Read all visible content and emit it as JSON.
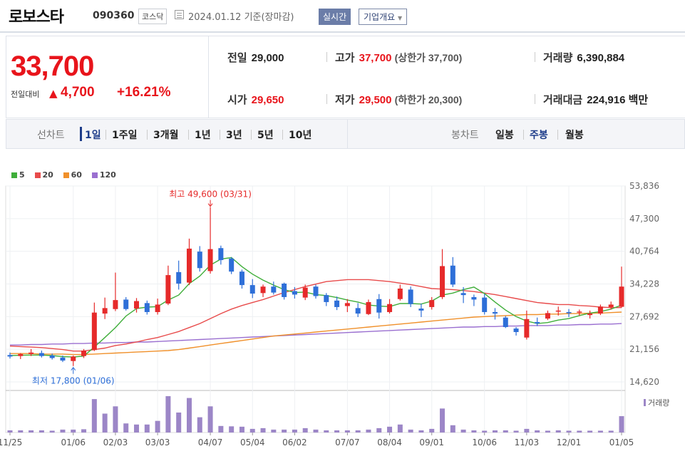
{
  "header": {
    "name": "로보스타",
    "code": "090360",
    "market": "코스닥",
    "date_text": "2024.01.12  기준(장마감)",
    "realtime_btn": "실시간",
    "corp_btn": "기업개요"
  },
  "quote": {
    "price": "33,700",
    "change_label": "전일대비",
    "change": "4,700",
    "change_pct": "+16.21%"
  },
  "info": {
    "prev_label": "전일",
    "prev": "29,000",
    "high_label": "고가",
    "high": "37,700",
    "upper_limit": "(상한가 37,700)",
    "volume_label": "거래량",
    "volume": "6,390,884",
    "open_label": "시가",
    "open": "29,650",
    "low_label": "저가",
    "low": "29,500",
    "lower_limit": "(하한가 20,300)",
    "amount_label": "거래대금",
    "amount": "224,916 백만"
  },
  "tabs": {
    "line_label": "선차트",
    "line_periods": [
      "1일",
      "1주일",
      "3개월",
      "1년",
      "3년",
      "5년",
      "10년"
    ],
    "candle_label": "봉차트",
    "candle_periods": [
      "일봉",
      "주봉",
      "월봉"
    ],
    "active_candle": "주봉"
  },
  "legend": [
    {
      "name": "5",
      "color": "#3fae3a"
    },
    {
      "name": "20",
      "color": "#e84b4b"
    },
    {
      "name": "60",
      "color": "#f0902a"
    },
    {
      "name": "120",
      "color": "#9a6fd0"
    }
  ],
  "chart_data": {
    "type": "candlestick",
    "period": "weekly",
    "y_ticks": [
      "53,836",
      "47,300",
      "40,764",
      "34,228",
      "27,692",
      "21,156",
      "14,620"
    ],
    "y_tick_values": [
      53836,
      47300,
      40764,
      34228,
      27692,
      21156,
      14620
    ],
    "x_ticks": [
      "11/25",
      "01/06",
      "02/03",
      "03/03",
      "04/07",
      "05/04",
      "06/02",
      "07/07",
      "08/04",
      "09/01",
      "10/06",
      "11/03",
      "12/01",
      "01/05"
    ],
    "x_tick_index": [
      0,
      6,
      10,
      14,
      19,
      23,
      27,
      32,
      36,
      40,
      45,
      49,
      53,
      58
    ],
    "high_annotation": "최고 49,600 (03/31)",
    "low_annotation": "최저 17,800 (01/06)",
    "volume_label": "거래량",
    "candles": [
      [
        20000,
        20500,
        19300,
        19700
      ],
      [
        19800,
        20400,
        19200,
        20200
      ],
      [
        20200,
        21200,
        19800,
        20500
      ],
      [
        20400,
        20900,
        19500,
        19800
      ],
      [
        19900,
        20300,
        19100,
        19400
      ],
      [
        19500,
        19900,
        18600,
        18900
      ],
      [
        18800,
        19900,
        17800,
        19700
      ],
      [
        19800,
        21200,
        19400,
        20900
      ],
      [
        21000,
        30500,
        20800,
        28500
      ],
      [
        28300,
        31500,
        27200,
        29400
      ],
      [
        29200,
        36500,
        28800,
        31000
      ],
      [
        31100,
        31600,
        28900,
        29200
      ],
      [
        29300,
        31400,
        28500,
        30800
      ],
      [
        30400,
        30900,
        28100,
        28600
      ],
      [
        28600,
        31300,
        28100,
        30100
      ],
      [
        30300,
        37900,
        30000,
        36000
      ],
      [
        36600,
        38900,
        33100,
        34300
      ],
      [
        34500,
        43300,
        34000,
        41300
      ],
      [
        40700,
        41800,
        36700,
        37400
      ],
      [
        36800,
        49600,
        36300,
        41200
      ],
      [
        41400,
        41900,
        38100,
        39000
      ],
      [
        39300,
        39600,
        36200,
        36700
      ],
      [
        36700,
        37100,
        33300,
        34000
      ],
      [
        34000,
        35200,
        31400,
        32300
      ],
      [
        32400,
        34100,
        31600,
        33700
      ],
      [
        33700,
        34700,
        32100,
        32500
      ],
      [
        34300,
        34500,
        31100,
        31600
      ],
      [
        32800,
        33600,
        31300,
        32100
      ],
      [
        31500,
        34100,
        31000,
        33500
      ],
      [
        33700,
        34100,
        31300,
        31800
      ],
      [
        32000,
        32400,
        29800,
        30600
      ],
      [
        30900,
        31700,
        29000,
        29600
      ],
      [
        29800,
        31200,
        28600,
        30400
      ],
      [
        29400,
        30400,
        27600,
        28300
      ],
      [
        28200,
        31100,
        28000,
        30600
      ],
      [
        31200,
        32200,
        27300,
        28500
      ],
      [
        28600,
        31200,
        28300,
        30200
      ],
      [
        31200,
        34100,
        30900,
        33300
      ],
      [
        33100,
        33700,
        29600,
        30200
      ],
      [
        29300,
        30300,
        27600,
        28900
      ],
      [
        29600,
        31600,
        29100,
        31000
      ],
      [
        31600,
        41200,
        31200,
        37800
      ],
      [
        37900,
        39600,
        33600,
        34100
      ],
      [
        32400,
        33600,
        30400,
        32000
      ],
      [
        31600,
        32100,
        29800,
        31100
      ],
      [
        31500,
        32200,
        28100,
        28600
      ],
      [
        28600,
        29400,
        27100,
        28300
      ],
      [
        27500,
        27800,
        25400,
        25600
      ],
      [
        25300,
        25600,
        23900,
        24600
      ],
      [
        23500,
        28900,
        23100,
        27200
      ],
      [
        26600,
        27500,
        25800,
        26300
      ],
      [
        27300,
        28900,
        27000,
        28400
      ],
      [
        28700,
        29700,
        27900,
        28900
      ],
      [
        28600,
        29200,
        27600,
        28500
      ],
      [
        28500,
        29100,
        27900,
        28700
      ],
      [
        28000,
        28900,
        27300,
        28300
      ],
      [
        28300,
        30100,
        28000,
        29700
      ],
      [
        29600,
        30700,
        29100,
        30100
      ],
      [
        29650,
        37700,
        29500,
        33700
      ]
    ],
    "ma5": [
      19900,
      19950,
      20000,
      20000,
      19900,
      19700,
      19600,
      19800,
      21600,
      23500,
      25500,
      27800,
      29300,
      29600,
      29700,
      31000,
      32000,
      34300,
      35800,
      38000,
      39200,
      39500,
      37700,
      36200,
      35000,
      34000,
      33100,
      32500,
      32600,
      32100,
      31900,
      31500,
      31000,
      30600,
      30000,
      29800,
      29700,
      30300,
      30300,
      30200,
      30800,
      32000,
      32400,
      33100,
      33600,
      32300,
      30600,
      29000,
      27700,
      26800,
      26300,
      26500,
      27000,
      27300,
      27900,
      28400,
      28700,
      29200,
      30000
    ],
    "ma20": [
      21800,
      21700,
      21600,
      21500,
      21300,
      21100,
      20800,
      20800,
      21100,
      21400,
      21900,
      22200,
      22600,
      23100,
      23500,
      24100,
      24700,
      25500,
      26300,
      27300,
      28300,
      29200,
      29900,
      30500,
      31100,
      31800,
      32500,
      33100,
      33700,
      34200,
      34700,
      34900,
      35100,
      35100,
      35100,
      34900,
      34700,
      34400,
      34100,
      33700,
      33300,
      33200,
      33100,
      32900,
      32700,
      32400,
      32100,
      31700,
      31300,
      30900,
      30500,
      30300,
      30100,
      30100,
      29900,
      29800,
      29600,
      29500,
      29500
    ],
    "ma60": [
      20300,
      20300,
      20300,
      20200,
      20200,
      20200,
      20100,
      20100,
      20200,
      20300,
      20400,
      20500,
      20600,
      20700,
      20800,
      20900,
      21100,
      21400,
      21700,
      22000,
      22300,
      22600,
      22900,
      23200,
      23500,
      23800,
      24000,
      24200,
      24400,
      24600,
      24800,
      25000,
      25200,
      25400,
      25600,
      25800,
      26000,
      26200,
      26400,
      26600,
      26800,
      27000,
      27200,
      27400,
      27600,
      27700,
      27800,
      27900,
      28000,
      28100,
      28100,
      28200,
      28200,
      28300,
      28300,
      28400,
      28400,
      28500,
      28600
    ],
    "ma120": [
      22000,
      22000,
      22100,
      22100,
      22200,
      22200,
      22300,
      22300,
      22400,
      22400,
      22500,
      22500,
      22600,
      22600,
      22700,
      22800,
      22900,
      23000,
      23100,
      23200,
      23300,
      23400,
      23500,
      23600,
      23700,
      23800,
      23900,
      24000,
      24100,
      24200,
      24300,
      24400,
      24500,
      24600,
      24700,
      24800,
      24900,
      25000,
      25100,
      25200,
      25300,
      25400,
      25500,
      25600,
      25600,
      25700,
      25700,
      25800,
      25800,
      25900,
      25900,
      25900,
      26000,
      26000,
      26100,
      26100,
      26200,
      26200,
      26300
    ],
    "volume": [
      0.06,
      0.06,
      0.06,
      0.06,
      0.05,
      0.08,
      0.08,
      0.09,
      0.92,
      0.52,
      0.72,
      0.25,
      0.22,
      0.22,
      0.32,
      1.0,
      0.55,
      0.95,
      0.42,
      0.72,
      0.18,
      0.17,
      0.16,
      0.1,
      0.12,
      0.08,
      0.08,
      0.08,
      0.12,
      0.08,
      0.06,
      0.06,
      0.06,
      0.06,
      0.08,
      0.12,
      0.16,
      0.22,
      0.08,
      0.06,
      0.1,
      0.66,
      0.2,
      0.08,
      0.06,
      0.05,
      0.06,
      0.06,
      0.05,
      0.1,
      0.06,
      0.05,
      0.06,
      0.05,
      0.05,
      0.05,
      0.05,
      0.05,
      0.45
    ]
  }
}
